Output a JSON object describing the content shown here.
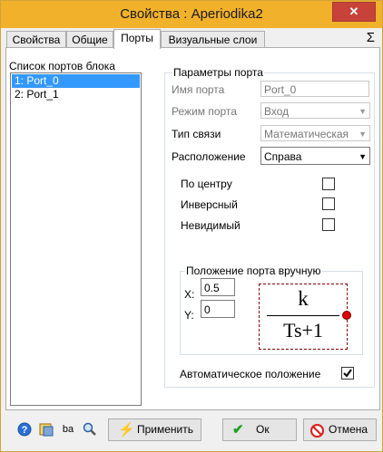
{
  "window": {
    "title": "Свойства : Aperiodika2",
    "close_icon": "close-icon"
  },
  "tabs": [
    {
      "label": "Свойства"
    },
    {
      "label": "Общие"
    },
    {
      "label": "Порты",
      "active": true
    },
    {
      "label": "Визуальные слои"
    }
  ],
  "sigma": "Σ",
  "ports_list": {
    "title": "Список портов блока",
    "items": [
      {
        "label": "1: Port_0",
        "selected": true
      },
      {
        "label": "2: Port_1"
      }
    ]
  },
  "port_params": {
    "title": "Параметры порта",
    "name_label": "Имя порта",
    "name_value": "Port_0",
    "mode_label": "Режим порта",
    "mode_value": "Вход",
    "link_label": "Тип связи",
    "link_value": "Математическая",
    "position_label": "Расположение",
    "position_value": "Справа",
    "center_label": "По центру",
    "center_checked": false,
    "inverse_label": "Инверсный",
    "inverse_checked": false,
    "invisible_label": "Невидимый",
    "invisible_checked": false
  },
  "manual": {
    "title": "Положение порта вручную",
    "x_label": "X:",
    "x_value": "0.5",
    "y_label": "Y:",
    "y_value": "0",
    "numerator": "k",
    "denominator": "Ts+1",
    "port_color": "#e00000"
  },
  "auto_position": {
    "label": "Автоматическое положение",
    "checked": true
  },
  "buttons": {
    "apply": "Применить",
    "ok": "Ок",
    "cancel": "Отмена"
  },
  "bottom_icons": [
    "help-icon",
    "properties-icon",
    "text-format-icon",
    "zoom-icon"
  ],
  "bottom_icon_text": "ba",
  "colors": {
    "titlebar": "#f2b12b",
    "selection": "#3399ff",
    "close": "#c7433a"
  }
}
